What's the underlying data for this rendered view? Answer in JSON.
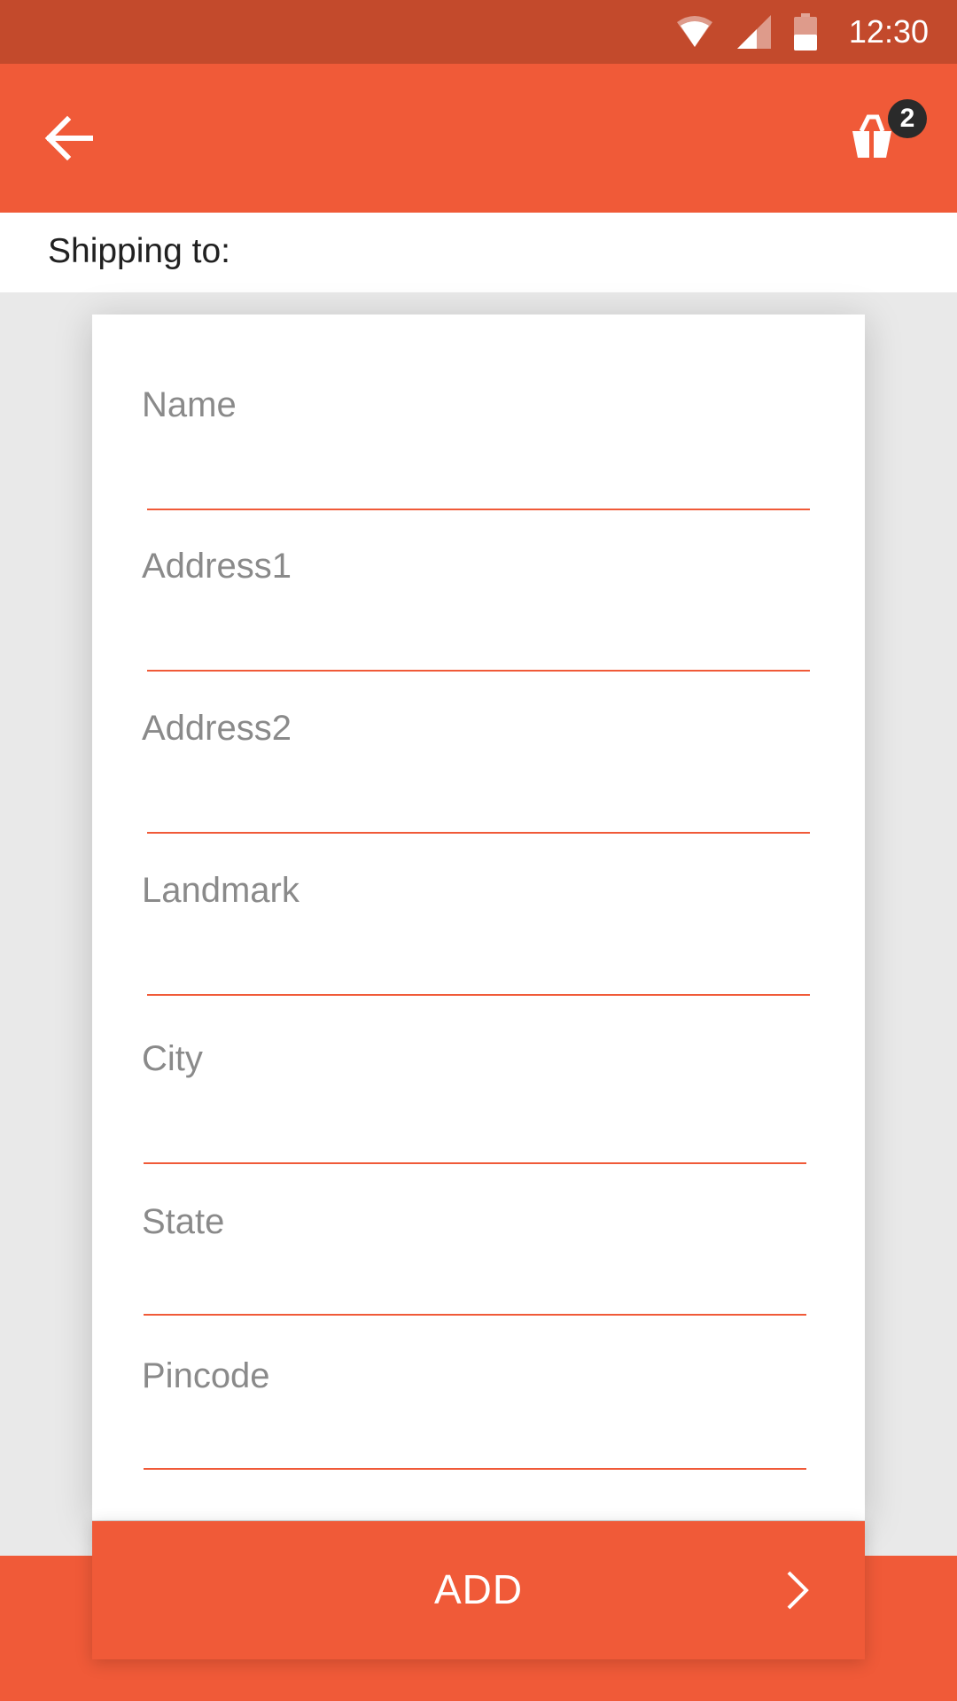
{
  "status_bar": {
    "time": "12:30",
    "icons": [
      "wifi-icon",
      "signal-icon",
      "battery-icon"
    ]
  },
  "app_bar": {
    "back_icon": "back-arrow-icon",
    "cart_icon": "shopping-bag-icon",
    "cart_count": "2"
  },
  "shipping": {
    "heading": "Shipping to:"
  },
  "form": {
    "fields": [
      {
        "label": "Name",
        "value": ""
      },
      {
        "label": "Address1",
        "value": ""
      },
      {
        "label": "Address2",
        "value": ""
      },
      {
        "label": "Landmark",
        "value": ""
      },
      {
        "label": "City",
        "value": ""
      },
      {
        "label": "State",
        "value": ""
      },
      {
        "label": "Pincode",
        "value": ""
      }
    ]
  },
  "actions": {
    "add_label": "ADD",
    "add_icon": "chevron-right-icon"
  },
  "colors": {
    "status_bar": "#c34a2c",
    "primary": "#f05a38",
    "background": "#e9e9e9",
    "label_gray": "#8a8a8a",
    "badge": "#2a2a2a"
  }
}
